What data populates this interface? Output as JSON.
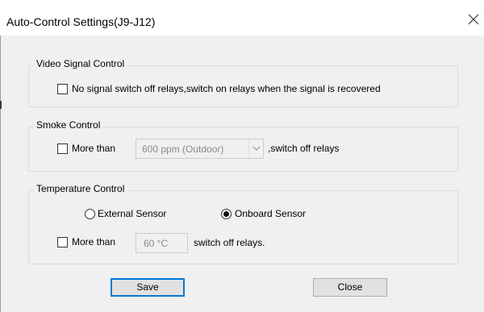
{
  "window": {
    "title": "Auto-Control Settings(J9-J12)",
    "close_icon": "close-icon"
  },
  "video_group": {
    "legend": "Video Signal Control",
    "checkbox_label": "No signal switch off relays,switch on relays when the signal is recovered",
    "checked": false
  },
  "smoke_group": {
    "legend": "Smoke Control",
    "checkbox_label": "More than",
    "checked": false,
    "select_value": "600 ppm (Outdoor)",
    "suffix": ",switch off relays"
  },
  "temperature_group": {
    "legend": "Temperature Control",
    "radio_external": "External  Sensor",
    "radio_onboard": "Onboard  Sensor",
    "selected_sensor": "Onboard  Sensor",
    "checkbox_label": "More than",
    "checked": false,
    "field_value": "60 °C",
    "suffix": "switch off relays."
  },
  "buttons": {
    "save": "Save",
    "close": "Close"
  }
}
